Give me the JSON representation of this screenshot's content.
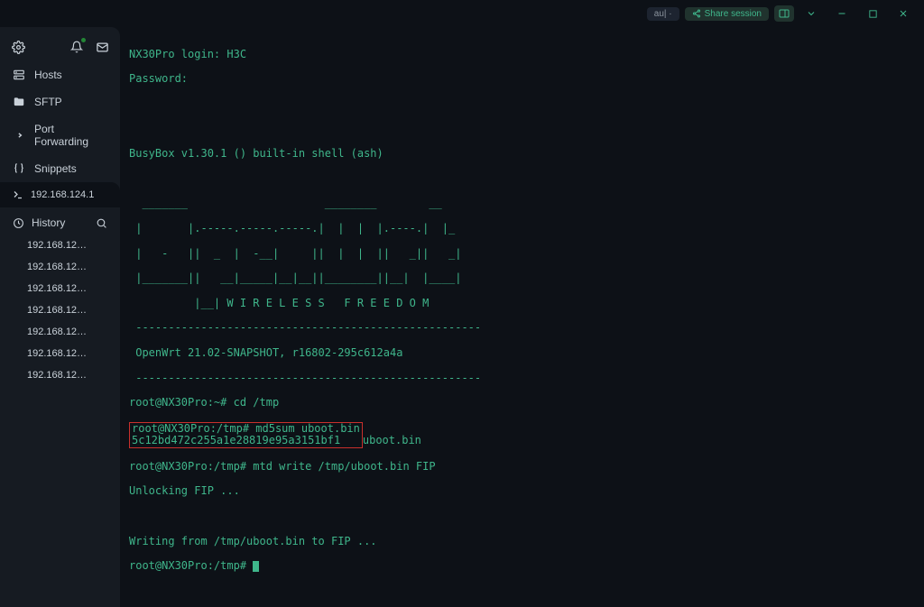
{
  "titlebar": {
    "pill_aul": "au| ·",
    "share_label": "Share session",
    "icons": {
      "layout": "layout-icon"
    }
  },
  "sidebar": {
    "nav": [
      {
        "icon": "hosts-icon",
        "label": "Hosts"
      },
      {
        "icon": "folder-icon",
        "label": "SFTP"
      },
      {
        "icon": "forward-icon",
        "label": "Port Forwarding"
      },
      {
        "icon": "braces-icon",
        "label": "Snippets"
      }
    ],
    "active_session": {
      "icon": "terminal-icon",
      "label": "192.168.124.1"
    },
    "history_label": "History",
    "history": [
      "192.168.12…",
      "192.168.12…",
      "192.168.12…",
      "192.168.12…",
      "192.168.12…",
      "192.168.12…",
      "192.168.12…"
    ]
  },
  "terminal": {
    "l1": "NX30Pro login: H3C",
    "l2": "Password:",
    "blank1": "",
    "l3": "BusyBox v1.30.1 () built-in shell (ash)",
    "ascii1": "  _______                     ________        __",
    "ascii2": " |       |.-----.-----.-----.|  |  |  |.----.|  |_",
    "ascii3": " |   -   ||  _  |  -__|     ||  |  |  ||   _||   _|",
    "ascii4": " |_______||   __|_____|__|__||________||__|  |____|",
    "ascii5": "          |__| W I R E L E S S   F R E E D O M",
    "div1": " -----------------------------------------------------",
    "l4": " OpenWrt 21.02-SNAPSHOT, r16802-295c612a4a",
    "div2": " -----------------------------------------------------",
    "p1_prompt": "root@NX30Pro:~# ",
    "p1_cmd": "cd /tmp",
    "p2_prompt": "root@NX30Pro:/tmp# ",
    "p2_cmd": "md5sum uboot.bin",
    "hash": "5c12bd472c255a1e28819e95a3151bf1  ",
    "hash_file": "uboot.bin",
    "p3_prompt": "root@NX30Pro:/tmp# ",
    "p3_cmd": "mtd write /tmp/uboot.bin FIP",
    "unlock": "Unlocking FIP ...",
    "writing": "Writing from /tmp/uboot.bin to FIP ...",
    "p4_prompt": "root@NX30Pro:/tmp# "
  }
}
